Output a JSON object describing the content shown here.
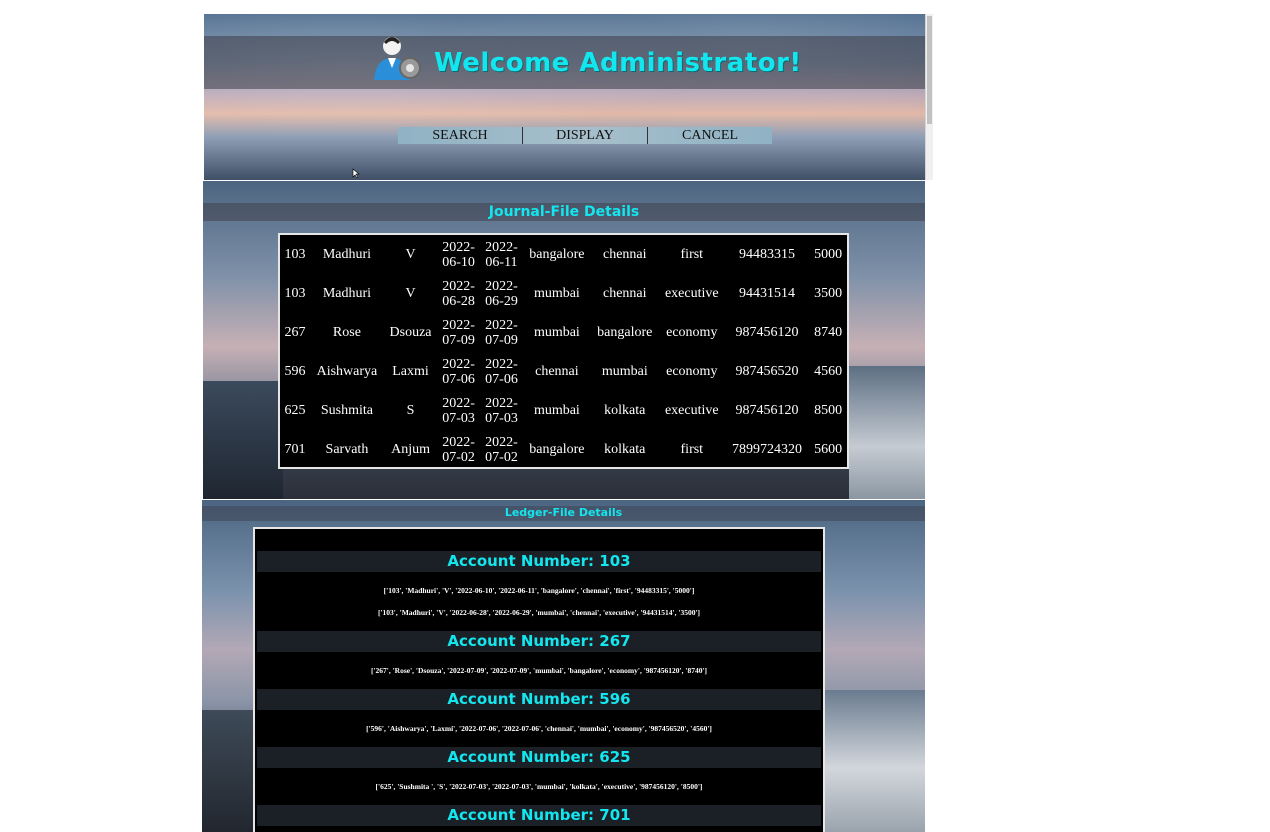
{
  "header": {
    "welcome": "Welcome Administrator!",
    "nav": [
      {
        "label": "SEARCH"
      },
      {
        "label": "DISPLAY"
      },
      {
        "label": "CANCEL"
      }
    ]
  },
  "journal": {
    "title": "Journal-File Details",
    "rows": [
      {
        "id": "103",
        "first": "Madhuri",
        "last": "V",
        "date1a": "2022-",
        "date1b": "06-10",
        "date2a": "2022-",
        "date2b": "06-11",
        "from": "bangalore",
        "to": "chennai",
        "class": "first",
        "phone": "94483315",
        "amount": "5000"
      },
      {
        "id": "103",
        "first": "Madhuri",
        "last": "V",
        "date1a": "2022-",
        "date1b": "06-28",
        "date2a": "2022-",
        "date2b": "06-29",
        "from": "mumbai",
        "to": "chennai",
        "class": "executive",
        "phone": "94431514",
        "amount": "3500"
      },
      {
        "id": "267",
        "first": "Rose",
        "last": "Dsouza",
        "date1a": "2022-",
        "date1b": "07-09",
        "date2a": "2022-",
        "date2b": "07-09",
        "from": "mumbai",
        "to": "bangalore",
        "class": "economy",
        "phone": "987456120",
        "amount": "8740"
      },
      {
        "id": "596",
        "first": "Aishwarya",
        "last": "Laxmi",
        "date1a": "2022-",
        "date1b": "07-06",
        "date2a": "2022-",
        "date2b": "07-06",
        "from": "chennai",
        "to": "mumbai",
        "class": "economy",
        "phone": "987456520",
        "amount": "4560"
      },
      {
        "id": "625",
        "first": "Sushmita",
        "last": "S",
        "date1a": "2022-",
        "date1b": "07-03",
        "date2a": "2022-",
        "date2b": "07-03",
        "from": "mumbai",
        "to": "kolkata",
        "class": "executive",
        "phone": "987456120",
        "amount": "8500"
      },
      {
        "id": "701",
        "first": "Sarvath",
        "last": "Anjum",
        "date1a": "2022-",
        "date1b": "07-02",
        "date2a": "2022-",
        "date2b": "07-02",
        "from": "bangalore",
        "to": "kolkata",
        "class": "first",
        "phone": "7899724320",
        "amount": "5600"
      }
    ]
  },
  "ledger": {
    "title": "Ledger-File Details",
    "accounts": [
      {
        "heading": "Account Number: 103",
        "records": [
          "['103', 'Madhuri', 'V', '2022-06-10', '2022-06-11', 'bangalore', 'chennai', 'first', '94483315', '5000']",
          "['103', 'Madhuri', 'V', '2022-06-28', '2022-06-29', 'mumbai', 'chennai', 'executive', '94431514', '3500']"
        ]
      },
      {
        "heading": "Account Number: 267",
        "records": [
          "['267', 'Rose', 'Dsouza', '2022-07-09', '2022-07-09', 'mumbai', 'bangalore', 'economy', '987456120', '8740']"
        ]
      },
      {
        "heading": "Account Number: 596",
        "records": [
          "['596', 'Aishwarya', 'Laxmi', '2022-07-06', '2022-07-06', 'chennai', 'mumbai', 'economy', '987456520', '4560']"
        ]
      },
      {
        "heading": "Account Number: 625",
        "records": [
          "['625', 'Sushmita ', 'S', '2022-07-03', '2022-07-03', 'mumbai', 'kolkata', 'executive', '987456120', '8500']"
        ]
      },
      {
        "heading": "Account Number: 701",
        "records": []
      }
    ]
  }
}
